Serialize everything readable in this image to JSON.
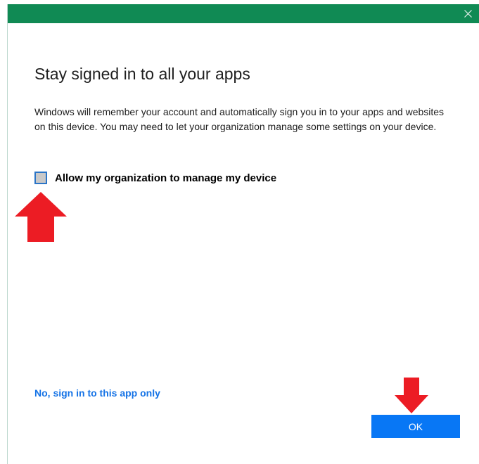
{
  "window": {
    "close_icon": "close-icon",
    "titlebar_color": "#108a54"
  },
  "dialog": {
    "heading": "Stay signed in to all your apps",
    "description": "Windows will remember your account and automatically sign you in to your apps and websites on this device. You may need to let your organization manage some settings on your device.",
    "checkbox": {
      "label": "Allow my organization to manage my device",
      "checked": false
    },
    "link_label": "No, sign in to this app only",
    "ok_label": "OK"
  },
  "annotations": {
    "arrow_color": "#ec1c24",
    "arrows": [
      "arrow-up-icon",
      "arrow-down-icon"
    ]
  },
  "colors": {
    "link": "#1573e6",
    "button": "#0877f5",
    "checkbox_border": "#2b75c7"
  }
}
